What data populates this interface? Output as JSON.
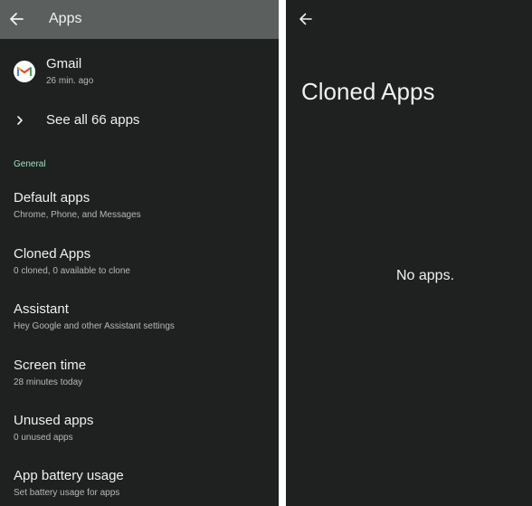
{
  "left": {
    "app_bar": {
      "title": "Apps"
    },
    "recent_app": {
      "name": "Gmail",
      "time": "26 min. ago"
    },
    "see_all": {
      "label": "See all 66 apps"
    },
    "section_header": "General",
    "items": [
      {
        "title": "Default apps",
        "summary": "Chrome, Phone, and Messages"
      },
      {
        "title": "Cloned Apps",
        "summary": "0 cloned, 0 available to clone"
      },
      {
        "title": "Assistant",
        "summary": "Hey Google and other Assistant settings"
      },
      {
        "title": "Screen time",
        "summary": "28 minutes today"
      },
      {
        "title": "Unused apps",
        "summary": "0 unused apps"
      },
      {
        "title": "App battery usage",
        "summary": "Set battery usage for apps"
      }
    ]
  },
  "right": {
    "title": "Cloned Apps",
    "empty_message": "No apps."
  },
  "colors": {
    "background": "#1f2020",
    "app_bar": "#5b5f5e",
    "section_header": "#9fe0bf",
    "divider": "#ffffff"
  },
  "icons": {
    "back": "back-arrow-icon",
    "gmail": "gmail-icon",
    "chevron": "chevron-right-icon"
  }
}
